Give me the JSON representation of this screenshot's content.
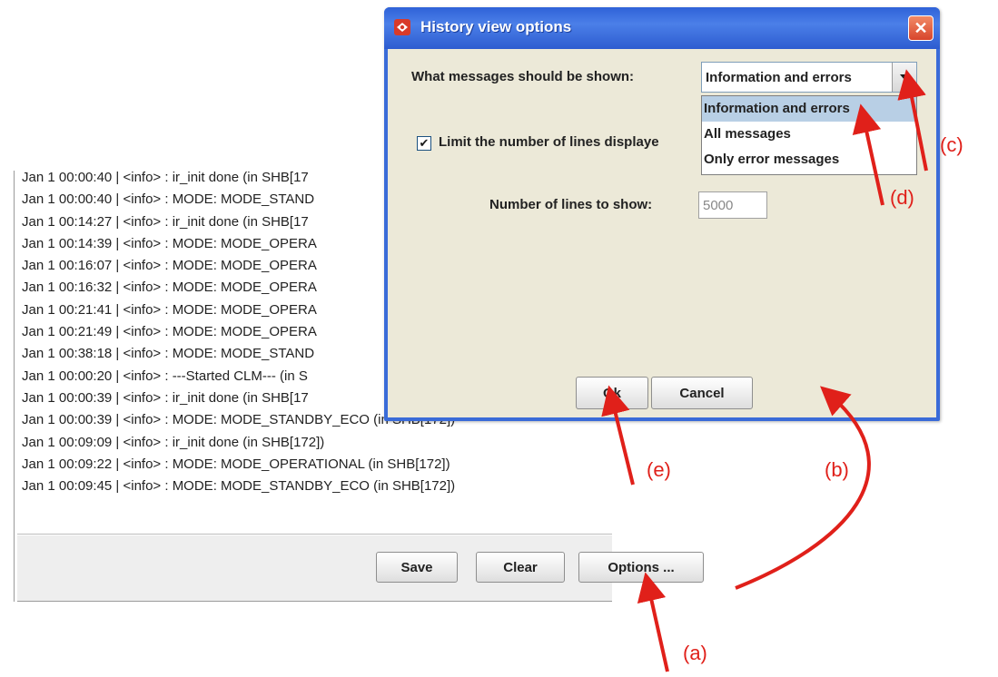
{
  "log": {
    "lines": [
      "Jan  1 00:00:40 | <info> : ir_init done (in  SHB[17",
      "Jan  1 00:00:40 | <info> : MODE: MODE_STAND",
      "Jan  1 00:14:27 | <info> : ir_init done (in  SHB[17",
      "Jan  1 00:14:39 | <info> : MODE: MODE_OPERA",
      "Jan  1 00:16:07 | <info> : MODE: MODE_OPERA",
      "Jan  1 00:16:32 | <info> : MODE: MODE_OPERA",
      "Jan  1 00:21:41 | <info> : MODE: MODE_OPERA",
      "Jan  1 00:21:49 | <info> : MODE: MODE_OPERA",
      "Jan  1 00:38:18 | <info> : MODE: MODE_STAND",
      "Jan  1 00:00:20 | <info> : ---Started CLM--- (in  S",
      "Jan  1 00:00:39 | <info> : ir_init done (in  SHB[17",
      "Jan  1 00:00:39 | <info> : MODE: MODE_STANDBY_ECO (in  SHB[172])",
      "Jan  1 00:09:09 | <info> : ir_init done (in  SHB[172])",
      "Jan  1 00:09:22 | <info> : MODE: MODE_OPERATIONAL (in  SHB[172])",
      "Jan  1 00:09:45 | <info> : MODE: MODE_STANDBY_ECO (in  SHB[172])"
    ],
    "buttons": {
      "save": "Save",
      "clear": "Clear",
      "options": "Options ..."
    }
  },
  "dialog": {
    "title": "History view options",
    "messages_label": "What messages should be shown:",
    "combo_value": "Information and errors",
    "dropdown_options": [
      "Information and errors",
      "All messages",
      "Only error messages"
    ],
    "limit_label": "Limit the number of lines displaye",
    "limit_checked": true,
    "num_lines_label": "Number of lines to show:",
    "num_lines_value": "5000",
    "ok_label": "Ok",
    "cancel_label": "Cancel",
    "close_glyph": "✕"
  },
  "annotations": {
    "a": "(a)",
    "b": "(b)",
    "c": "(c)",
    "d": "(d)",
    "e": "(e)",
    "color": "#e0201a"
  }
}
